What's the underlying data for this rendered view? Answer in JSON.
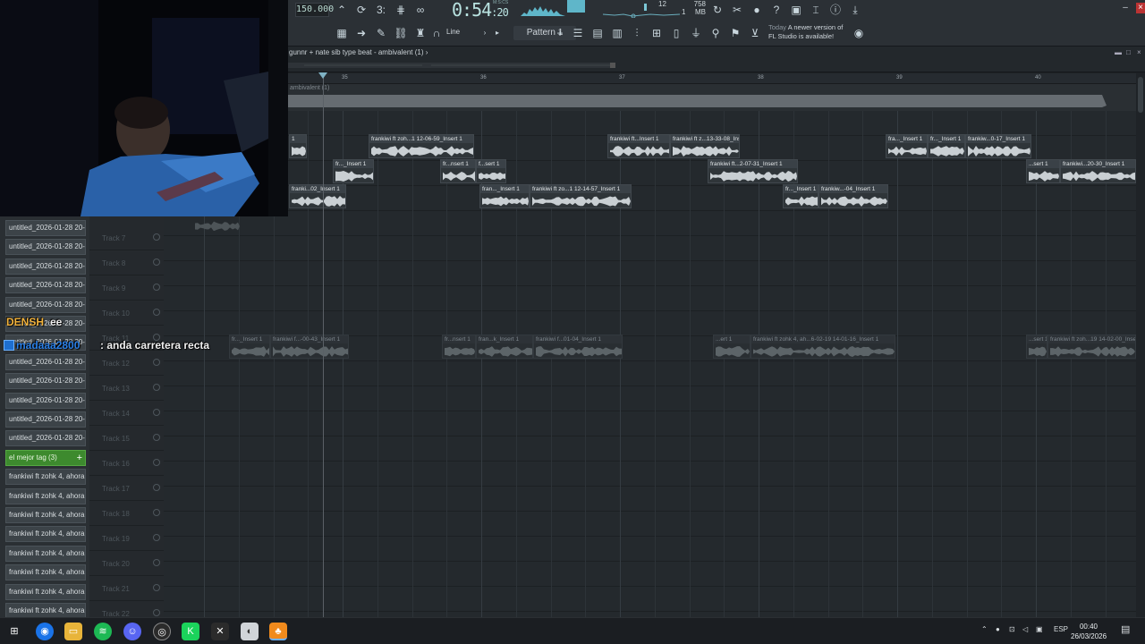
{
  "toolbar": {
    "tempo": "150.000",
    "time_main": "0:54",
    "time_sub": ":20",
    "time_unit": "M:S:CS",
    "memory": "758 MB",
    "polyphony": "12",
    "cpu_value": "1",
    "pattern": "Pattern 1",
    "snap_mode": "Line",
    "news_today": "Today",
    "news_text_1": "A newer version of",
    "news_text_2": "FL Studio is available!"
  },
  "playlist": {
    "title": "gunnr + nate sib type beat - ambivalent (1)",
    "title_arrow": "›",
    "overview_label": "ambivalent (1)",
    "bars": [
      "35",
      "36",
      "37",
      "38",
      "39",
      "40"
    ]
  },
  "tracks": [
    "Track 7",
    "Track 8",
    "Track 9",
    "Track 10",
    "Track 11",
    "Track 12",
    "Track 13",
    "Track 14",
    "Track 15",
    "Track 16",
    "Track 17",
    "Track 18",
    "Track 19",
    "Track 20",
    "Track 21",
    "Track 22"
  ],
  "clips_row1": [
    {
      "label": "1"
    },
    {
      "label": "frankiwi ft zoh...1 12-06-59_Insert 1"
    },
    {
      "label": "frankiwi ft...Insert 1"
    },
    {
      "label": "frankiwi ft z...13-33-08_Insert 1"
    },
    {
      "label": "fra..._Insert 1"
    },
    {
      "label": "fr..._Insert 1"
    },
    {
      "label": "frankiw...0-17_Insert 1"
    }
  ],
  "clips_row2": [
    {
      "label": "fr..._Insert 1"
    },
    {
      "label": "fr...nsert 1"
    },
    {
      "label": "f...sert 1"
    },
    {
      "label": "frankiwi ft...2-07-31_Insert 1"
    },
    {
      "label": "...sert 1"
    },
    {
      "label": "frankiwi...20-30_Insert 1"
    }
  ],
  "clips_row3": [
    {
      "label": "franki...02_Insert 1"
    },
    {
      "label": "fran..._Insert 1"
    },
    {
      "label": "frankiwi ft zo...1 12-14-57_Insert 1"
    },
    {
      "label": "fr..._Insert 1"
    },
    {
      "label": "frankiw...-04_Insert 1"
    }
  ],
  "clips_row11": [
    {
      "label": "fr..._Insert 1"
    },
    {
      "label": "frankiwi f...-00-43_Insert 1"
    },
    {
      "label": "fr...nsert 1"
    },
    {
      "label": "fran...k_Insert 1"
    },
    {
      "label": "frankiwi f...01-04_Insert 1"
    },
    {
      "label": "...ert 1"
    },
    {
      "label": "frankiwi ft zohk 4, ah...6-02-19 14-01-16_Insert 1"
    },
    {
      "label": "...sert 1"
    },
    {
      "label": "frankiwi ft zoh...19 14-02-00_Insert 1"
    }
  ],
  "picker": [
    "untitled_2026-01-28 20-...",
    "untitled_2026-01-28 20-...",
    "untitled_2026-01-28 20-...",
    "untitled_2026-01-28 20-...",
    "untitled_2026-01-28 20-...",
    "untitled_2026-01-28 20-...",
    "untitled_2026-01-28 20-...",
    "untitled_2026-01-28 20-...",
    "untitled_2026-01-28 20-...",
    "untitled_2026-01-28 20-...",
    "untitled_2026-01-28 20-...",
    "untitled_2026-01-28 20-...",
    "el mejor tag (3)",
    "frankiwi ft zohk 4, ahora...",
    "frankiwi ft zohk 4, ahora...",
    "frankiwi ft zohk 4, ahora...",
    "frankiwi ft zohk 4, ahora...",
    "frankiwi ft zohk 4, ahora...",
    "frankiwi ft zohk 4, ahora...",
    "frankiwi ft zohk 4, ahora...",
    "frankiwi ft zohk 4, ahora..."
  ],
  "chat": {
    "user1": "DENSH",
    "msg1": "ee",
    "user2": "madaaa2800",
    "msg2": ": anda carretera recta"
  },
  "taskbar": {
    "lang": "ESP",
    "time": "00:40",
    "date": "26/03/2026"
  }
}
